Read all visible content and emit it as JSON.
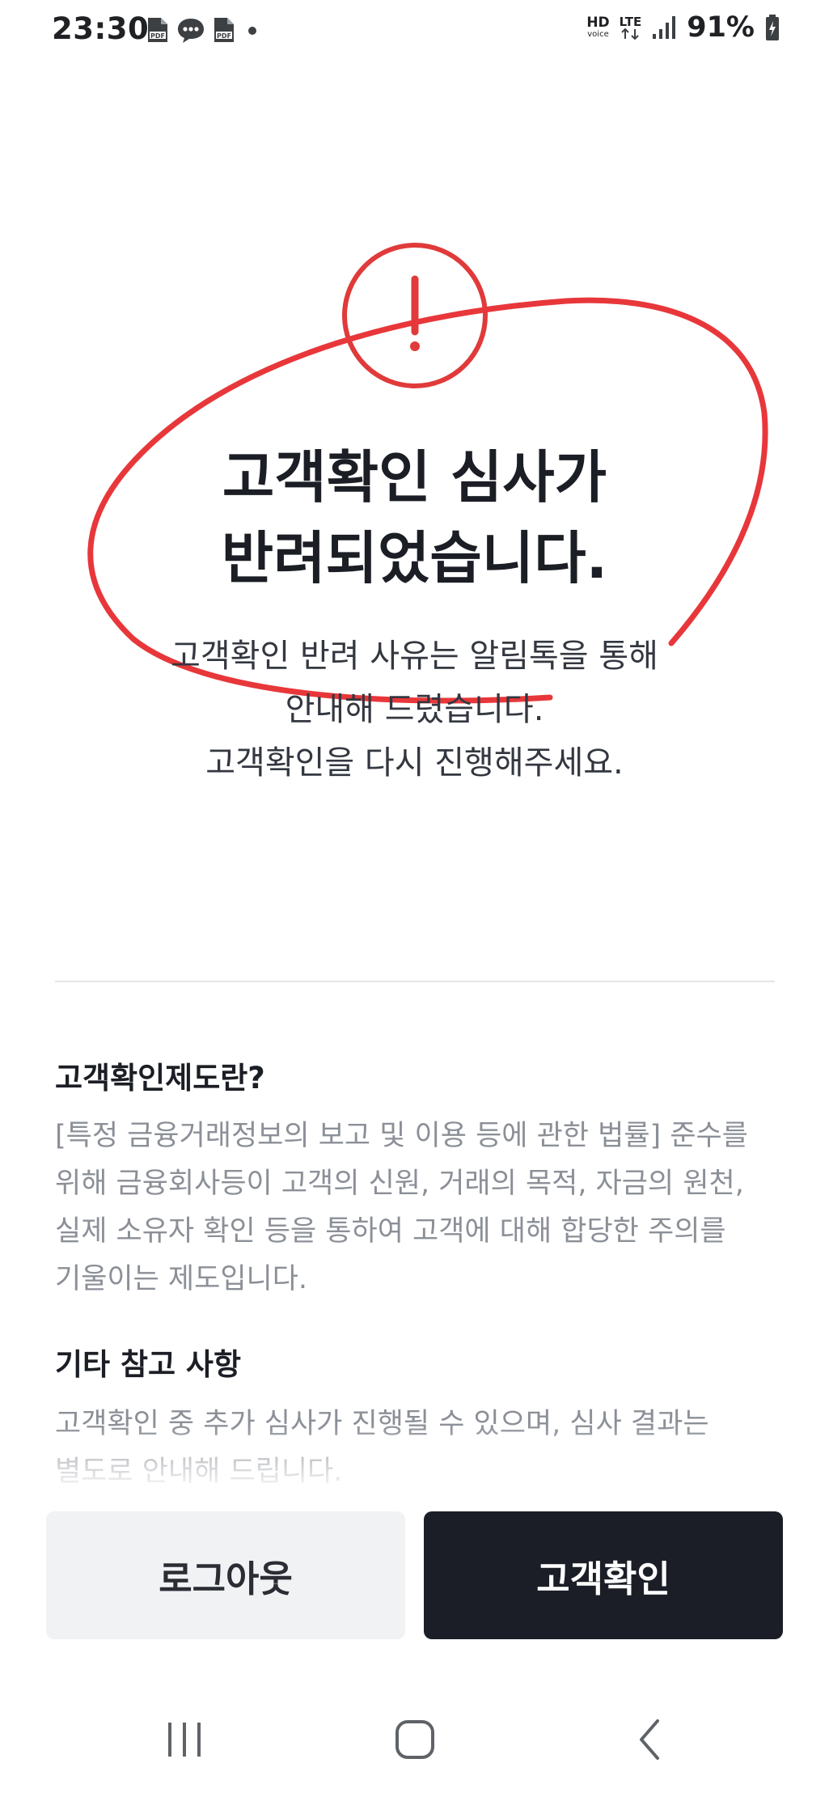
{
  "status_bar": {
    "time": "23:30",
    "hd_label": "HD",
    "voice_label": "voice",
    "lte_label": "LTE",
    "battery": "91%"
  },
  "screen": {
    "title_line1": "고객확인 심사가",
    "title_line2": "반려되었습니다.",
    "subtitle_line1": "고객확인 반려 사유는 알림톡을 통해",
    "subtitle_line2": "안내해 드렸습니다.",
    "subtitle_line3": "고객확인을 다시 진행해주세요.",
    "alert_color": "#e03a3a"
  },
  "info": {
    "section1_title": "고객확인제도란?",
    "section1_body": "[특정 금융거래정보의 보고 및 이용 등에 관한 법률] 준수를 위해 금융회사등이 고객의 신원, 거래의 목적, 자금의 원천, 실제 소유자 확인 등을 통하여 고객에 대해 합당한 주의를 기울이는 제도입니다.",
    "section2_title": "기타 참고 사항",
    "section2_body": "고객확인 중 추가 심사가 진행될 수 있으며, 심사 결과는 별도로 안내해 드립니다."
  },
  "buttons": {
    "logout_label": "로그아웃",
    "verify_label": "고객확인"
  },
  "nav": {
    "recents_icon": "recents-icon",
    "home_icon": "home-icon",
    "back_icon": "back-icon"
  }
}
